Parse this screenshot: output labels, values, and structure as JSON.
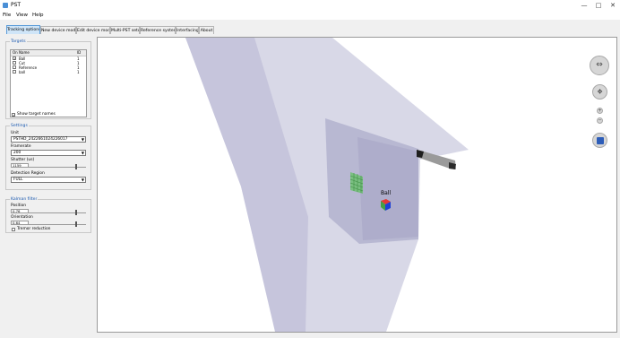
{
  "window": {
    "title": "PST",
    "minimize_glyph": "—",
    "restore_glyph": "□",
    "close_glyph": "✕"
  },
  "menu": [
    "File",
    "View",
    "Help"
  ],
  "tabs": [
    {
      "label": "Tracking options",
      "active": true
    },
    {
      "label": "New device model",
      "active": false
    },
    {
      "label": "Edit device model",
      "active": false
    },
    {
      "label": "Multi-PST setup",
      "active": false
    },
    {
      "label": "Reference system",
      "active": false
    },
    {
      "label": "Interfacing",
      "active": false
    },
    {
      "label": "About",
      "active": false
    }
  ],
  "targets": {
    "group_title": "Targets",
    "columns": [
      "On",
      "Name",
      "ID"
    ],
    "rows": [
      {
        "on": true,
        "name": "Ball",
        "id": "1"
      },
      {
        "on": false,
        "name": "Cut",
        "id": "1"
      },
      {
        "on": false,
        "name": "Reference",
        "id": "1"
      },
      {
        "on": false,
        "name": "ball",
        "id": "1"
      }
    ],
    "show_names_label": "Show target names",
    "show_names_checked": true
  },
  "settings": {
    "group_title": "Settings",
    "unit_label": "Unit",
    "unit_value": "PSTHD_2422661024226017",
    "framerate_label": "Framerate",
    "framerate_value": "200",
    "shutter_label": "Shutter (us)",
    "shutter_value": "1159",
    "shutter_level": 0.88,
    "detection_label": "Detection Region",
    "detection_value": "FULL"
  },
  "kalman": {
    "group_title": "Kalman filter",
    "position_label": "Position",
    "position_value": "0.76",
    "position_level": 0.88,
    "orientation_label": "Orientation",
    "orientation_value": "0.64",
    "orientation_level": 0.88,
    "tremor_label": "Tremor reduction",
    "tremor_checked": false
  },
  "viewport": {
    "target_label": "Ball",
    "nav_rotate_glyph": "⇔",
    "nav_pan_glyph": "✥",
    "zoom_in_glyph": "+",
    "zoom_out_glyph": "−",
    "stop_glyph": "■",
    "colors": {
      "frustum": "#c7c6dc",
      "accent": "#5a9bd8",
      "record_button": "#2d5db8"
    }
  }
}
